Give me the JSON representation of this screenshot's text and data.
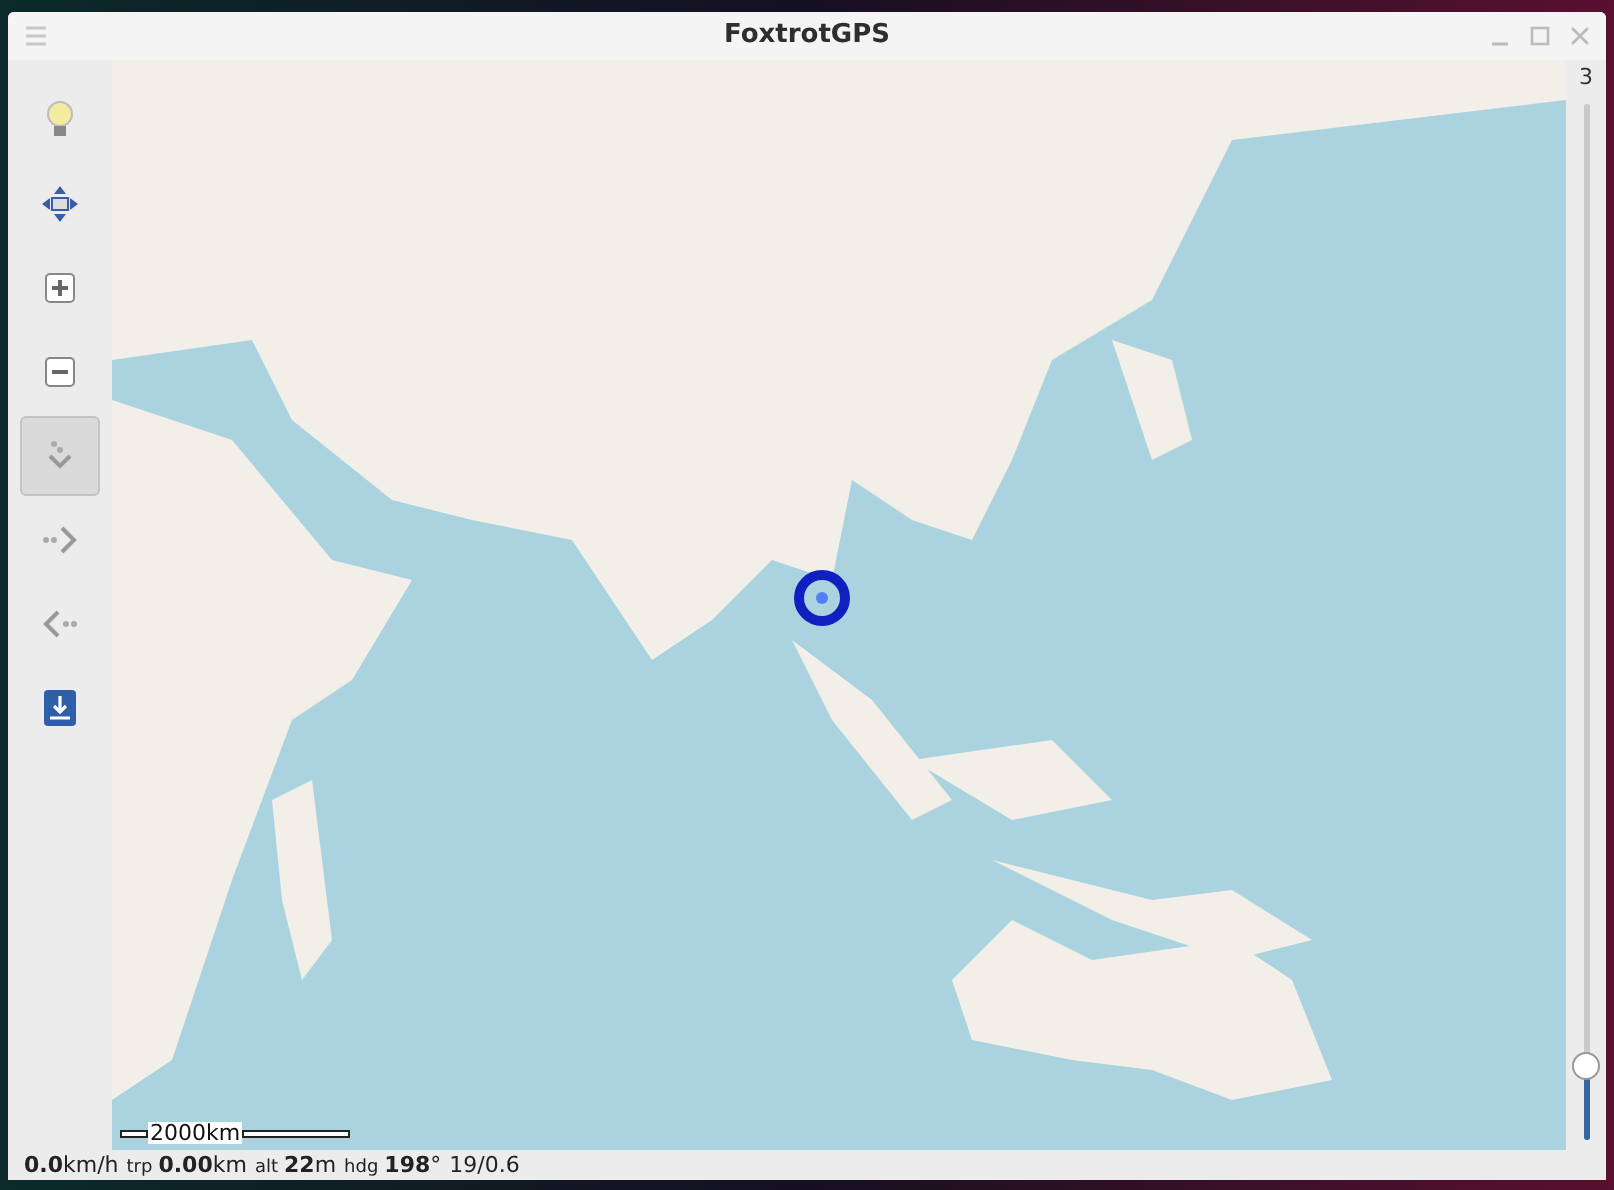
{
  "window": {
    "title": "FoxtrotGPS"
  },
  "tools": [
    {
      "kind": "bulb",
      "selected": false
    },
    {
      "kind": "move",
      "selected": false
    },
    {
      "kind": "zoom-in",
      "selected": false
    },
    {
      "kind": "zoom-out",
      "selected": false
    },
    {
      "kind": "autocenter",
      "selected": true
    },
    {
      "kind": "next",
      "selected": false
    },
    {
      "kind": "prev",
      "selected": false
    },
    {
      "kind": "download",
      "selected": false
    }
  ],
  "zoom": {
    "value": "3",
    "level": 0.07
  },
  "map": {
    "scale": "2000km"
  },
  "status_bar": {
    "readings": [
      {
        "value": "0.0",
        "unit": "km/h"
      },
      {
        "label": "trp",
        "value": "0.00",
        "unit": "km"
      },
      {
        "label": "alt",
        "value": "22",
        "unit": "m"
      },
      {
        "label": "hdg",
        "value": "198",
        "unit": "°"
      }
    ],
    "extra": "19/0.6"
  }
}
